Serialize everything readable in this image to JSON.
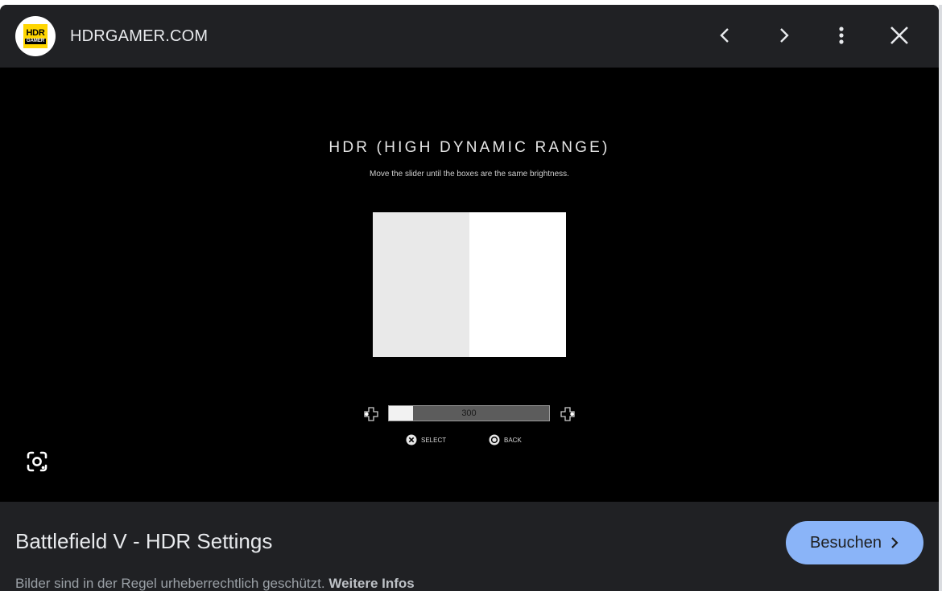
{
  "header": {
    "favicon_top": "HDR",
    "favicon_bottom": "GAMER",
    "site_name": "HDRGAMER.COM"
  },
  "icons": {
    "prev": "chevron-left-icon",
    "next": "chevron-right-icon",
    "more": "more-vert-icon",
    "close": "close-icon",
    "lens": "google-lens-icon"
  },
  "image_content": {
    "title": "HDR (HIGH DYNAMIC RANGE)",
    "subtitle": "Move the slider until the boxes are the same brightness.",
    "slider_value": "300",
    "slider_fill_fraction": 0.15,
    "select_label": "SELECT",
    "back_label": "BACK"
  },
  "footer": {
    "image_title": "Battlefield V - HDR Settings",
    "visit_label": "Besuchen",
    "copyright_text": "Bilder sind in der Regel urheberrechtlich geschützt.",
    "more_info_link": "Weitere Infos"
  },
  "colors": {
    "panel_bg": "#202124",
    "viewer_bg": "#000000",
    "accent": "#8ab4f8",
    "favicon_yellow": "#ffd600"
  }
}
